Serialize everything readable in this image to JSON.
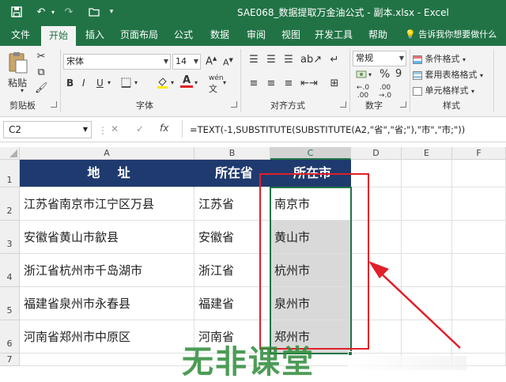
{
  "title": "SAE068_数据提取万金油公式 - 副本.xlsx  -  Excel",
  "tabs": [
    "文件",
    "开始",
    "插入",
    "页面布局",
    "公式",
    "数据",
    "审阅",
    "视图",
    "开发工具",
    "帮助"
  ],
  "tell_me": "告诉我你想要做什么",
  "ribbon": {
    "clipboard": {
      "paste": "粘贴",
      "label": "剪贴板"
    },
    "font": {
      "name": "宋体",
      "size": "14",
      "increase": "A",
      "decrease": "A",
      "label": "字体",
      "bold": "B",
      "italic": "I",
      "underline": "U",
      "wen": "wén"
    },
    "alignment": {
      "label": "对齐方式"
    },
    "number": {
      "format": "常规",
      "label": "数字",
      "percent": "%",
      "comma": "9"
    },
    "styles": {
      "conditional": "条件格式",
      "table": "套用表格格式",
      "cell": "单元格样式",
      "label": "样式"
    }
  },
  "formula_bar": {
    "name_box": "C2",
    "cancel": "✕",
    "enter": "✓",
    "fx": "fx",
    "formula": "=TEXT(-1,SUBSTITUTE(SUBSTITUTE(A2,\"省\",\"省;\"),\"市\",\"市;\"))"
  },
  "columns": [
    "A",
    "B",
    "C",
    "D",
    "E",
    "F"
  ],
  "rows": [
    "1",
    "2",
    "3",
    "4",
    "5",
    "6",
    "7"
  ],
  "table": {
    "headers": [
      "地    址",
      "所在省",
      "所在市"
    ],
    "data": [
      [
        "江苏省南京市江宁区万县",
        "江苏省",
        "南京市"
      ],
      [
        "安徽省黄山市歙县",
        "安徽省",
        "黄山市"
      ],
      [
        "浙江省杭州市千岛湖市",
        "浙江省",
        "杭州市"
      ],
      [
        "福建省泉州市永春县",
        "福建省",
        "泉州市"
      ],
      [
        "河南省郑州市中原区",
        "河南省",
        "郑州市"
      ]
    ]
  },
  "watermark": "无非课堂",
  "colors": {
    "excel_green": "#217346",
    "header_navy": "#1f3a6e",
    "annotation_red": "#e0202a"
  }
}
